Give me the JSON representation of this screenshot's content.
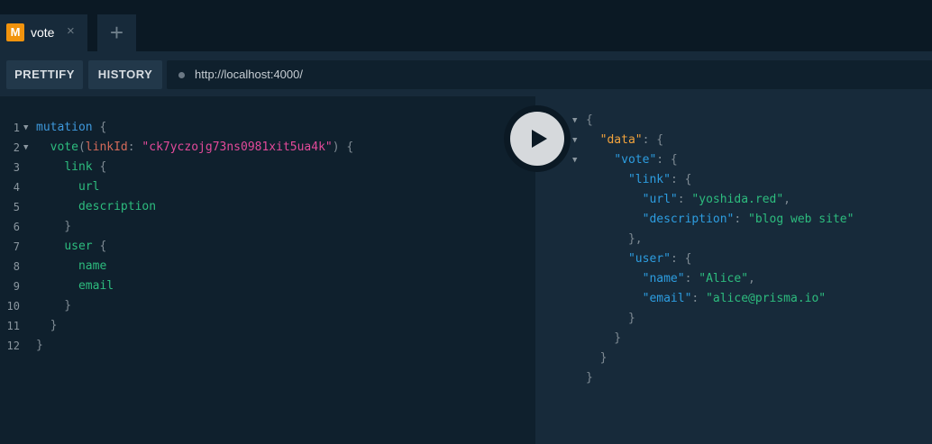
{
  "tab": {
    "badge": "M",
    "title": "vote",
    "close_icon": "×"
  },
  "add_tab_icon": "+",
  "toolbar": {
    "prettify_label": "PRETTIFY",
    "history_label": "HISTORY",
    "url": "http://localhost:4000/"
  },
  "query_lines": [
    {
      "no": "1",
      "fold": true,
      "text": "mutation {"
    },
    {
      "no": "2",
      "fold": true,
      "text": "  vote(linkId: \"ck7yczojg73ns0981xit5ua4k\") {"
    },
    {
      "no": "3",
      "fold": false,
      "text": "    link {"
    },
    {
      "no": "4",
      "fold": false,
      "text": "      url"
    },
    {
      "no": "5",
      "fold": false,
      "text": "      description"
    },
    {
      "no": "6",
      "fold": false,
      "text": "    }"
    },
    {
      "no": "7",
      "fold": false,
      "text": "    user {"
    },
    {
      "no": "8",
      "fold": false,
      "text": "      name"
    },
    {
      "no": "9",
      "fold": false,
      "text": "      email"
    },
    {
      "no": "10",
      "fold": false,
      "text": "    }"
    },
    {
      "no": "11",
      "fold": false,
      "text": "  }"
    },
    {
      "no": "12",
      "fold": false,
      "text": "}"
    }
  ],
  "result_lines": [
    {
      "fold": true,
      "text": "{"
    },
    {
      "fold": true,
      "text": "  \"data\": {"
    },
    {
      "fold": true,
      "text": "    \"vote\": {"
    },
    {
      "fold": false,
      "text": "      \"link\": {"
    },
    {
      "fold": false,
      "text": "        \"url\": \"yoshida.red\","
    },
    {
      "fold": false,
      "text": "        \"description\": \"blog web site\""
    },
    {
      "fold": false,
      "text": "      },"
    },
    {
      "fold": false,
      "text": "      \"user\": {"
    },
    {
      "fold": false,
      "text": "        \"name\": \"Alice\","
    },
    {
      "fold": false,
      "text": "        \"email\": \"alice@prisma.io\""
    },
    {
      "fold": false,
      "text": "      }"
    },
    {
      "fold": false,
      "text": "    }"
    },
    {
      "fold": false,
      "text": "  }"
    },
    {
      "fold": false,
      "text": "}"
    }
  ],
  "colors": {
    "accent": "#f1930d",
    "keyword": "#3e98db",
    "field": "#2dbc7e",
    "argument": "#d36a5a",
    "string": "#e34a9a",
    "json_key": "#2d9de0",
    "data_key": "#f2a33c"
  }
}
